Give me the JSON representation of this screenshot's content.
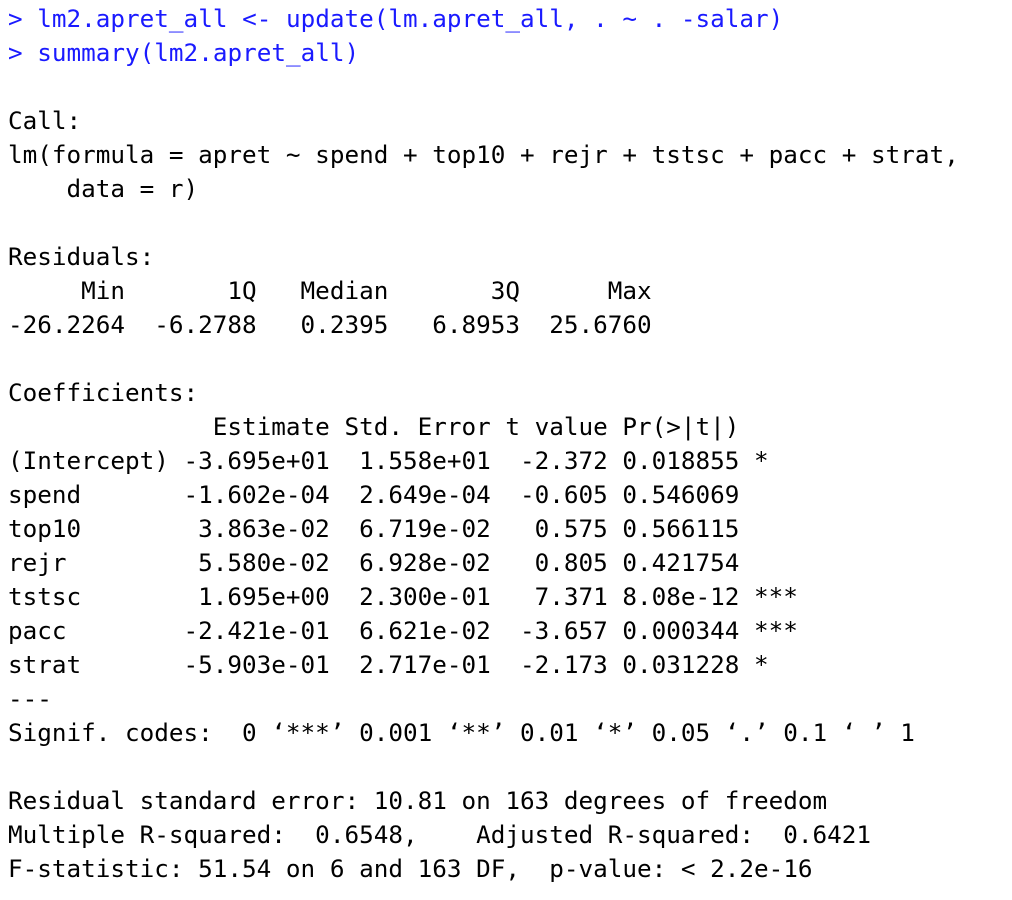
{
  "colors": {
    "background": "#ffffff",
    "input_text": "#1a1aff",
    "output_text": "#000000"
  },
  "console": {
    "prompt": ">",
    "input_lines": [
      "lm2.apret_all <- update(lm.apret_all, . ~ . -salar)",
      "summary(lm2.apret_all)"
    ],
    "call": {
      "header": "Call:",
      "formula_line1": "lm(formula = apret ~ spend + top10 + rejr + tstsc + pacc + strat,",
      "formula_line2": "    data = r)"
    },
    "residuals": {
      "header": "Residuals:",
      "columns_line": "     Min       1Q   Median       3Q      Max",
      "values_line": "-26.2264  -6.2788   0.2395   6.8953  25.6760"
    },
    "coefficients": {
      "header": "Coefficients:",
      "columns_line": "              Estimate Std. Error t value Pr(>|t|)",
      "rows": [
        "(Intercept) -3.695e+01  1.558e+01  -2.372 0.018855 *",
        "spend       -1.602e-04  2.649e-04  -0.605 0.546069",
        "top10        3.863e-02  6.719e-02   0.575 0.566115",
        "rejr         5.580e-02  6.928e-02   0.805 0.421754",
        "tstsc        1.695e+00  2.300e-01   7.371 8.08e-12 ***",
        "pacc        -2.421e-01  6.621e-02  -3.657 0.000344 ***",
        "strat       -5.903e-01  2.717e-01  -2.173 0.031228 *"
      ],
      "separator": "---",
      "signif_codes": "Signif. codes:  0 ‘***’ 0.001 ‘**’ 0.01 ‘*’ 0.05 ‘.’ 0.1 ‘ ’ 1"
    },
    "fit": {
      "residual_se": "Residual standard error: 10.81 on 163 degrees of freedom",
      "r_squared": "Multiple R-squared:  0.6548,\tAdjusted R-squared:  0.6421 ",
      "f_statistic": "F-statistic: 51.54 on 6 and 163 DF,  p-value: < 2.2e-16"
    }
  }
}
